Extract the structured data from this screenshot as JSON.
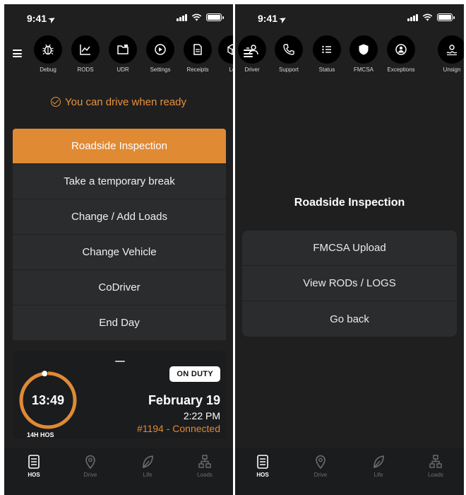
{
  "screens": {
    "left": {
      "status_time": "9:41",
      "toolbar": [
        {
          "label": "Debug",
          "icon": "bug-icon"
        },
        {
          "label": "RODS",
          "icon": "chart-icon"
        },
        {
          "label": "UDR",
          "icon": "folder-icon"
        },
        {
          "label": "Settings",
          "icon": "settings-icon"
        },
        {
          "label": "Receipts",
          "icon": "receipt-icon"
        },
        {
          "label": "Lo",
          "icon": "cube-icon"
        }
      ],
      "ready_text": "You can drive when ready",
      "actions": [
        "Roadside Inspection",
        "Take a temporary break",
        "Change / Add Loads",
        "Change Vehicle",
        "CoDriver",
        "End Day"
      ],
      "status_card": {
        "clock": "13:49",
        "hos_label": "14H HOS",
        "duty": "ON DUTY",
        "date": "February 19",
        "time": "2:22 PM",
        "connection": "#1194 - Connected",
        "ring_fraction": 0.98
      }
    },
    "right": {
      "status_time": "9:41",
      "toolbar": [
        {
          "label": "Driver",
          "icon": "driver-icon"
        },
        {
          "label": "Support",
          "icon": "phone-icon"
        },
        {
          "label": "Status",
          "icon": "list-icon"
        },
        {
          "label": "FMCSA",
          "icon": "shield-icon"
        },
        {
          "label": "Exceptions",
          "icon": "exceptions-icon"
        },
        {
          "label": "Unsign",
          "icon": "signature-icon"
        }
      ],
      "modal_title": "Roadside Inspection",
      "options": [
        "FMCSA Upload",
        "View RODs / LOGS",
        "Go back"
      ]
    }
  },
  "tabs": [
    {
      "label": "HOS",
      "icon": "hos-icon",
      "active": true
    },
    {
      "label": "Drive",
      "icon": "location-pin-icon",
      "active": false
    },
    {
      "label": "Life",
      "icon": "leaf-icon",
      "active": false
    },
    {
      "label": "Loads",
      "icon": "loads-icon",
      "active": false
    }
  ],
  "colors": {
    "accent": "#e08a34",
    "background": "#1f1f20",
    "panel": "#2a2c2e"
  }
}
